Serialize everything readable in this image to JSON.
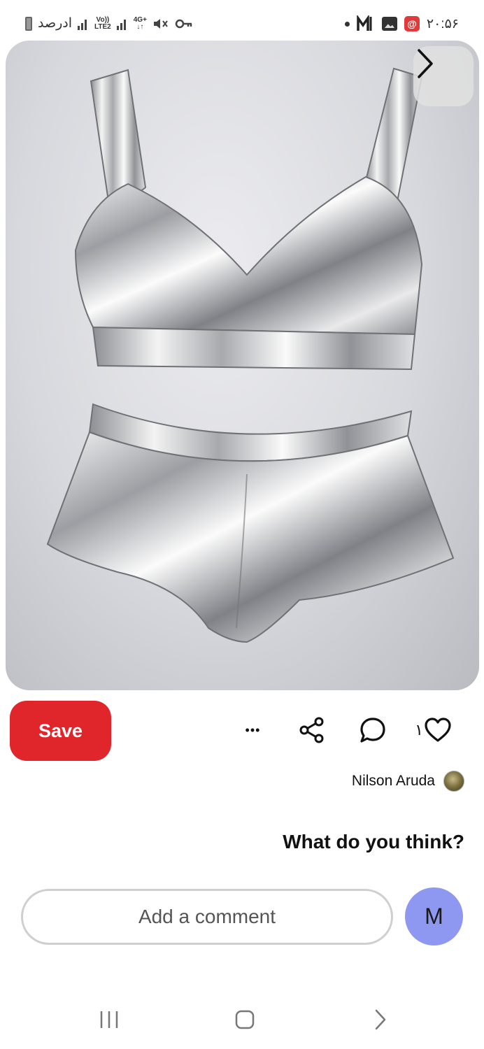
{
  "status_bar": {
    "battery_text": "ادرصد",
    "volte_top": "Vo))",
    "volte_bottom": "LTE2",
    "network_top": "4G+",
    "network_bottom": "↓↑",
    "clock": "۲۰:۵۶",
    "app_icon_letter": "M",
    "badge_symbol": "@"
  },
  "pin": {
    "image_subject": "metallic silver bra top and shorts",
    "next_icon": "chevron-right-icon"
  },
  "actions": {
    "save_label": "Save",
    "more_label": "• • •",
    "share_icon": "share-icon",
    "comment_icon": "comment-icon",
    "like_icon": "heart-icon",
    "like_count": "۱"
  },
  "creator": {
    "name": "Nilson Aruda"
  },
  "feedback": {
    "prompt": "What do you think?",
    "comment_placeholder": "Add a comment",
    "user_initial": "M"
  },
  "navigation": {
    "recents_icon": "recents-icon",
    "home_icon": "home-icon",
    "back_icon": "back-icon"
  },
  "colors": {
    "save_red": "#e0262b",
    "avatar_blue": "#8f98f0",
    "badge_red": "#e03a3a"
  }
}
